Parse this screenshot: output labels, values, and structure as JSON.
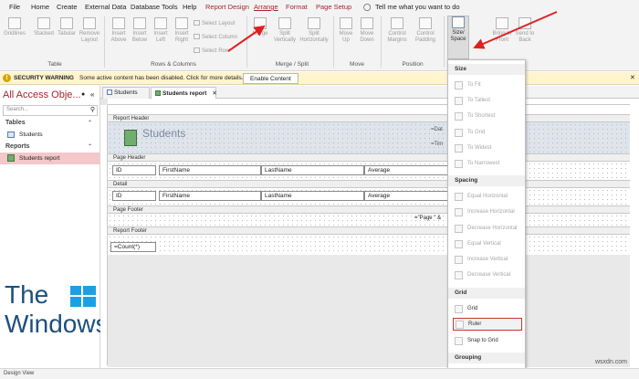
{
  "menubar": {
    "items": [
      "File",
      "Home",
      "Create",
      "External Data",
      "Database Tools",
      "Help",
      "Report Design",
      "Arrange",
      "Format",
      "Page Setup"
    ],
    "tell_me": "Tell me what you want to do"
  },
  "ribbon": {
    "table_group": {
      "label": "Table",
      "buttons": [
        "Gridlines",
        "Stacked",
        "Tabular",
        "Remove Layout"
      ]
    },
    "rows_group": {
      "label": "Rows & Columns",
      "buttons": [
        "Insert Above",
        "Insert Below",
        "Insert Left",
        "Insert Right"
      ],
      "small": [
        "Select Layout",
        "Select Column",
        "Select Row"
      ]
    },
    "merge_group": {
      "label": "Merge / Split",
      "buttons": [
        "Merge",
        "Split Vertically",
        "Split Horizontally"
      ]
    },
    "move_group": {
      "label": "Move",
      "buttons": [
        "Move Up",
        "Move Down"
      ]
    },
    "position_group": {
      "label": "Position",
      "buttons": [
        "Control Margins",
        "Control Padding"
      ]
    },
    "sizing": {
      "size_space": "Size/ Space",
      "bring_front": "Bring to Front",
      "send_back": "Send to Back"
    }
  },
  "security": {
    "label": "SECURITY WARNING",
    "message": "Some active content has been disabled. Click for more details.",
    "button": "Enable Content"
  },
  "nav": {
    "title": "All Access Obje...",
    "search_placeholder": "Search...",
    "tables_header": "Tables",
    "tables": [
      "Students"
    ],
    "reports_header": "Reports",
    "reports": [
      "Students report"
    ]
  },
  "tabs": [
    "Students",
    "Students report"
  ],
  "report": {
    "report_header": "Report Header",
    "title": "Students",
    "date_field": "=Dat",
    "time_field": "=Tim",
    "page_header": "Page Header",
    "header_labels": [
      "ID",
      "FirstName",
      "LastName",
      "Average"
    ],
    "detail": "Detail",
    "detail_fields": [
      "ID",
      "FirstName",
      "LastName",
      "Average"
    ],
    "page_footer": "Page Footer",
    "page_expr": "=\"Page \" &",
    "report_footer": "Report Footer",
    "count_expr": "=Count(*)"
  },
  "dropdown": {
    "size_header": "Size",
    "size_items": [
      "To Fit",
      "To Tallest",
      "To Shortest",
      "To Grid",
      "To Widest",
      "To Narrowest"
    ],
    "spacing_header": "Spacing",
    "spacing_items": [
      "Equal Horizontal",
      "Increase Horizontal",
      "Decrease Horizontal",
      "Equal Vertical",
      "Increase Vertical",
      "Decrease Vertical"
    ],
    "grid_header": "Grid",
    "grid_items": [
      "Grid",
      "Ruler",
      "Snap to Grid"
    ],
    "grouping_header": "Grouping"
  },
  "watermark": {
    "line1": "The",
    "line2": "WindowsClub"
  },
  "site_mark": "wsxdn.com",
  "status": "Design View",
  "colors": {
    "accent": "#a4262c",
    "warning_bg": "#fff4ce",
    "arrow": "#e02020"
  }
}
